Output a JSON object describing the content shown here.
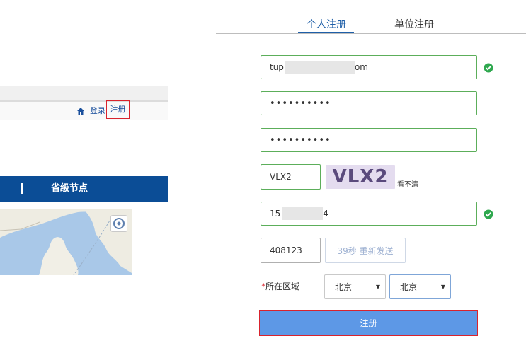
{
  "left": {
    "login_label": "登录",
    "register_label": "注册",
    "section_title": "省级节点"
  },
  "tabs": [
    {
      "label": "个人注册",
      "active": true
    },
    {
      "label": "单位注册",
      "active": false
    }
  ],
  "form": {
    "email": {
      "prefix": "tup",
      "suffix": "om",
      "valid": true
    },
    "password": {
      "value": "••••••••••"
    },
    "confirm_password": {
      "value": "••••••••••"
    },
    "captcha": {
      "value": "VLX2",
      "image_text": "VLX2",
      "refresh_label": "看不清"
    },
    "phone": {
      "prefix": "15",
      "suffix": "4",
      "valid": true
    },
    "sms_code": {
      "value": "408123",
      "resend_label": "39秒 重新发送"
    },
    "region": {
      "required_mark": "*",
      "label": "所在区域",
      "province": "北京",
      "city": "北京"
    },
    "submit_label": "注册"
  },
  "colors": {
    "valid_border": "#5cae5a",
    "valid_check": "#2fa84f",
    "primary_button": "#5d98e6",
    "highlight_red": "#d9232d",
    "header_blue": "#0b4d96"
  }
}
